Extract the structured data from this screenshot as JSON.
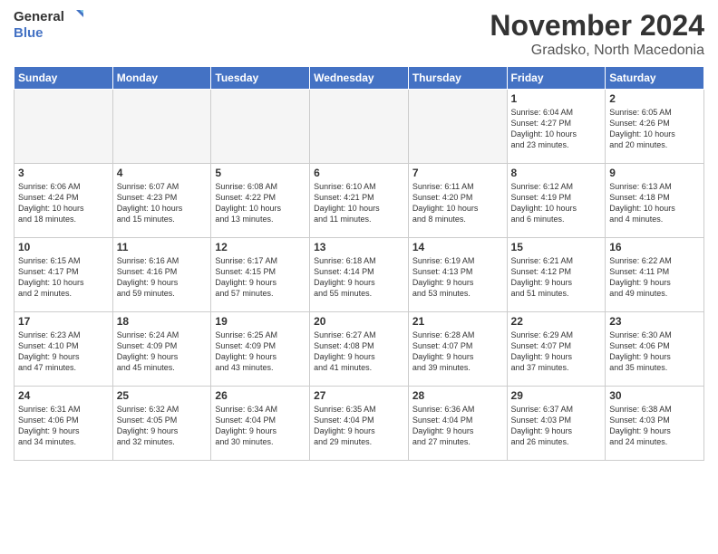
{
  "logo": {
    "line1": "General",
    "line2": "Blue"
  },
  "title": "November 2024",
  "location": "Gradsko, North Macedonia",
  "days_of_week": [
    "Sunday",
    "Monday",
    "Tuesday",
    "Wednesday",
    "Thursday",
    "Friday",
    "Saturday"
  ],
  "weeks": [
    [
      {
        "day": "",
        "info": ""
      },
      {
        "day": "",
        "info": ""
      },
      {
        "day": "",
        "info": ""
      },
      {
        "day": "",
        "info": ""
      },
      {
        "day": "",
        "info": ""
      },
      {
        "day": "1",
        "info": "Sunrise: 6:04 AM\nSunset: 4:27 PM\nDaylight: 10 hours\nand 23 minutes."
      },
      {
        "day": "2",
        "info": "Sunrise: 6:05 AM\nSunset: 4:26 PM\nDaylight: 10 hours\nand 20 minutes."
      }
    ],
    [
      {
        "day": "3",
        "info": "Sunrise: 6:06 AM\nSunset: 4:24 PM\nDaylight: 10 hours\nand 18 minutes."
      },
      {
        "day": "4",
        "info": "Sunrise: 6:07 AM\nSunset: 4:23 PM\nDaylight: 10 hours\nand 15 minutes."
      },
      {
        "day": "5",
        "info": "Sunrise: 6:08 AM\nSunset: 4:22 PM\nDaylight: 10 hours\nand 13 minutes."
      },
      {
        "day": "6",
        "info": "Sunrise: 6:10 AM\nSunset: 4:21 PM\nDaylight: 10 hours\nand 11 minutes."
      },
      {
        "day": "7",
        "info": "Sunrise: 6:11 AM\nSunset: 4:20 PM\nDaylight: 10 hours\nand 8 minutes."
      },
      {
        "day": "8",
        "info": "Sunrise: 6:12 AM\nSunset: 4:19 PM\nDaylight: 10 hours\nand 6 minutes."
      },
      {
        "day": "9",
        "info": "Sunrise: 6:13 AM\nSunset: 4:18 PM\nDaylight: 10 hours\nand 4 minutes."
      }
    ],
    [
      {
        "day": "10",
        "info": "Sunrise: 6:15 AM\nSunset: 4:17 PM\nDaylight: 10 hours\nand 2 minutes."
      },
      {
        "day": "11",
        "info": "Sunrise: 6:16 AM\nSunset: 4:16 PM\nDaylight: 9 hours\nand 59 minutes."
      },
      {
        "day": "12",
        "info": "Sunrise: 6:17 AM\nSunset: 4:15 PM\nDaylight: 9 hours\nand 57 minutes."
      },
      {
        "day": "13",
        "info": "Sunrise: 6:18 AM\nSunset: 4:14 PM\nDaylight: 9 hours\nand 55 minutes."
      },
      {
        "day": "14",
        "info": "Sunrise: 6:19 AM\nSunset: 4:13 PM\nDaylight: 9 hours\nand 53 minutes."
      },
      {
        "day": "15",
        "info": "Sunrise: 6:21 AM\nSunset: 4:12 PM\nDaylight: 9 hours\nand 51 minutes."
      },
      {
        "day": "16",
        "info": "Sunrise: 6:22 AM\nSunset: 4:11 PM\nDaylight: 9 hours\nand 49 minutes."
      }
    ],
    [
      {
        "day": "17",
        "info": "Sunrise: 6:23 AM\nSunset: 4:10 PM\nDaylight: 9 hours\nand 47 minutes."
      },
      {
        "day": "18",
        "info": "Sunrise: 6:24 AM\nSunset: 4:09 PM\nDaylight: 9 hours\nand 45 minutes."
      },
      {
        "day": "19",
        "info": "Sunrise: 6:25 AM\nSunset: 4:09 PM\nDaylight: 9 hours\nand 43 minutes."
      },
      {
        "day": "20",
        "info": "Sunrise: 6:27 AM\nSunset: 4:08 PM\nDaylight: 9 hours\nand 41 minutes."
      },
      {
        "day": "21",
        "info": "Sunrise: 6:28 AM\nSunset: 4:07 PM\nDaylight: 9 hours\nand 39 minutes."
      },
      {
        "day": "22",
        "info": "Sunrise: 6:29 AM\nSunset: 4:07 PM\nDaylight: 9 hours\nand 37 minutes."
      },
      {
        "day": "23",
        "info": "Sunrise: 6:30 AM\nSunset: 4:06 PM\nDaylight: 9 hours\nand 35 minutes."
      }
    ],
    [
      {
        "day": "24",
        "info": "Sunrise: 6:31 AM\nSunset: 4:06 PM\nDaylight: 9 hours\nand 34 minutes."
      },
      {
        "day": "25",
        "info": "Sunrise: 6:32 AM\nSunset: 4:05 PM\nDaylight: 9 hours\nand 32 minutes."
      },
      {
        "day": "26",
        "info": "Sunrise: 6:34 AM\nSunset: 4:04 PM\nDaylight: 9 hours\nand 30 minutes."
      },
      {
        "day": "27",
        "info": "Sunrise: 6:35 AM\nSunset: 4:04 PM\nDaylight: 9 hours\nand 29 minutes."
      },
      {
        "day": "28",
        "info": "Sunrise: 6:36 AM\nSunset: 4:04 PM\nDaylight: 9 hours\nand 27 minutes."
      },
      {
        "day": "29",
        "info": "Sunrise: 6:37 AM\nSunset: 4:03 PM\nDaylight: 9 hours\nand 26 minutes."
      },
      {
        "day": "30",
        "info": "Sunrise: 6:38 AM\nSunset: 4:03 PM\nDaylight: 9 hours\nand 24 minutes."
      }
    ]
  ]
}
